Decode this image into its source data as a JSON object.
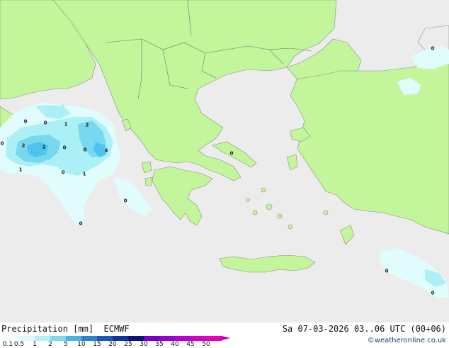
{
  "map": {
    "region": "Greece and surrounding seas",
    "land_color": "#c3f59b",
    "sea_color": "#ececec",
    "precip_colors": {
      "light": "#e0fcfc",
      "medium": "#aaf0f5",
      "heavy": "#78d8f0",
      "strong": "#4ec3ef"
    },
    "value_labels": [
      "0",
      "0",
      "1",
      "2",
      "0",
      "2",
      "2",
      "0",
      "4",
      "1",
      "0",
      "1",
      "0",
      "0",
      "0",
      "0",
      "0"
    ]
  },
  "legend": {
    "title": "Precipitation [mm]  ECMWF",
    "ticks": [
      "0.1",
      "0.5",
      "1",
      "2",
      "5",
      "10",
      "15",
      "20",
      "25",
      "30",
      "35",
      "40",
      "45",
      "50"
    ],
    "colors": [
      "#f5fcfc",
      "#e0fafa",
      "#b4f0f5",
      "#7dd8f0",
      "#46b4e6",
      "#2a82d0",
      "#1e5ab4",
      "#14329a",
      "#0a1478",
      "#7800c8",
      "#9600d2",
      "#b400d2",
      "#d200c8",
      "#e600b4"
    ]
  },
  "run_info": "Sa 07-03-2026 03..06 UTC (00+06)",
  "credit": "©weatheronline.co.uk"
}
